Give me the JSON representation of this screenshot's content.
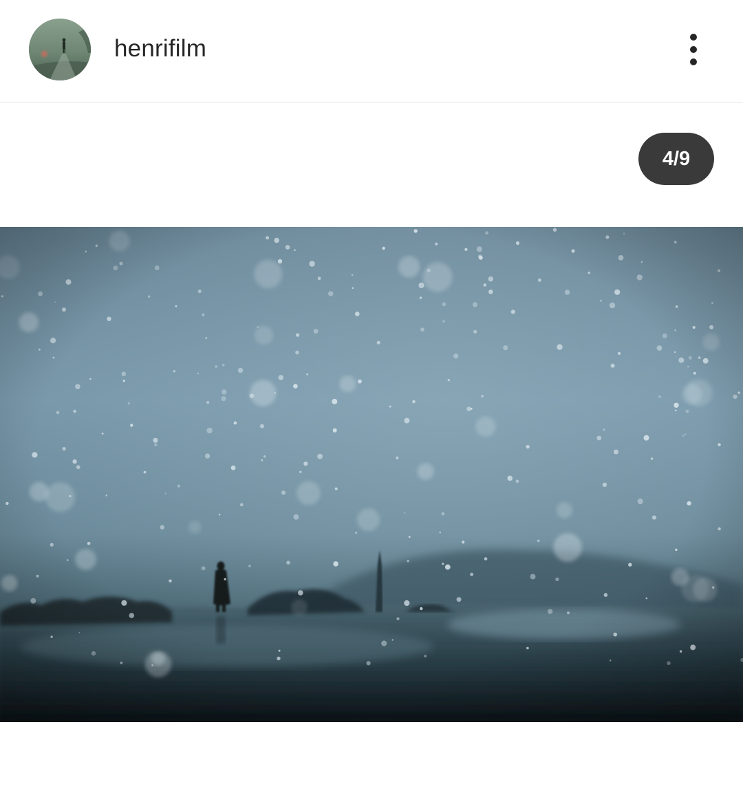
{
  "post": {
    "username": "henrifilm",
    "avatar_icon": "profile-photo-figure-on-road",
    "menu_icon": "more-vertical-icon"
  },
  "carousel": {
    "counter": "4/9",
    "current": 4,
    "total": 9
  },
  "photo": {
    "description_icon": "snowy-landscape-lone-figure",
    "palette": {
      "sky_top": "#6f8ea0",
      "sky_mid": "#7b9aad",
      "horizon": "#4e6b78",
      "ground": "#26363f",
      "ground_dark": "#121c22",
      "figure": "#141c20",
      "snow": "#dde8ee"
    }
  }
}
